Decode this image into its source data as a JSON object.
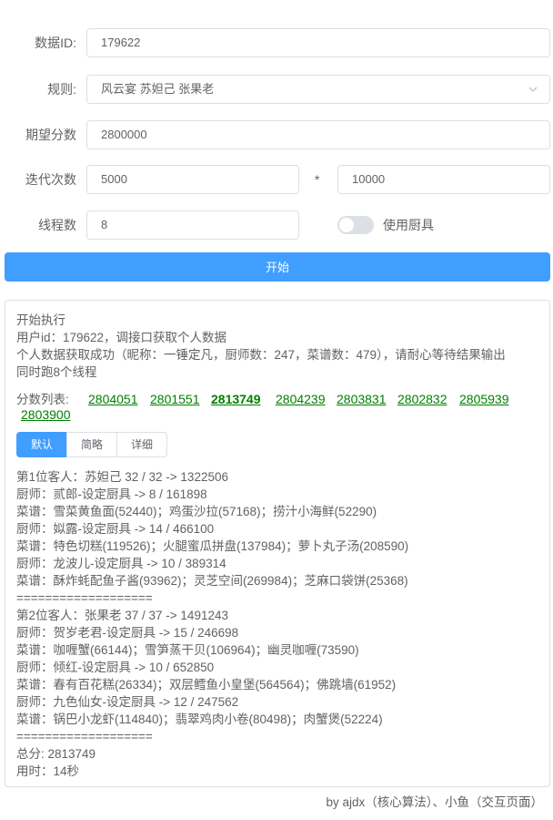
{
  "form": {
    "data_id": {
      "label": "数据ID:",
      "value": "179622"
    },
    "rule": {
      "label": "规则:",
      "value": "风云宴 苏妲己 张果老"
    },
    "expected_score": {
      "label": "期望分数",
      "value": "2800000"
    },
    "iterations": {
      "label": "迭代次数",
      "value_a": "5000",
      "multiply": "*",
      "value_b": "10000"
    },
    "threads": {
      "label": "线程数",
      "value": "8"
    },
    "use_tools": {
      "label": "使用厨具",
      "enabled": false
    }
  },
  "start_button": "开始",
  "output": {
    "log": [
      "开始执行",
      "用户id：179622，调接口获取个人数据",
      "个人数据获取成功（昵称：一锤定凡，厨师数：247，菜谱数：479），请耐心等待结果输出",
      "同时跑8个线程"
    ],
    "scores_label": "分数列表:",
    "scores": [
      "2804051",
      "2801551",
      "2813749",
      "2804239",
      "2803831",
      "2802832",
      "2805939",
      "2803900"
    ],
    "best_index": 2,
    "tabs": [
      "默认",
      "简略",
      "详细"
    ],
    "active_tab": 0,
    "result_lines": [
      "第1位客人：苏妲己 32 / 32 -> 1322506",
      "厨师：贰郎-设定厨具 -> 8 / 161898",
      "菜谱：雪菜黄鱼面(52440)；鸡蛋沙拉(57168)；捞汁小海鲜(52290)",
      "厨师：姒露-设定厨具 -> 14 / 466100",
      "菜谱：特色切糕(119526)；火腿蜜瓜拼盘(137984)；萝卜丸子汤(208590)",
      "厨师：龙波儿-设定厨具 -> 10 / 389314",
      "菜谱：酥炸蚝配鱼子酱(93962)；灵芝空间(269984)；芝麻口袋饼(25368)",
      "===================",
      "第2位客人：张果老 37 / 37 -> 1491243",
      "厨师：贺岁老君-设定厨具 -> 15 / 246698",
      "菜谱：咖喱蟹(66144)；雪笋蒸干贝(106964)；幽灵咖喱(73590)",
      "厨师：倾红-设定厨具 -> 10 / 652850",
      "菜谱：春有百花糕(26334)；双层鳕鱼小皇堡(564564)；佛跳墙(61952)",
      "厨师：九色仙女-设定厨具 -> 12 / 247562",
      "菜谱：锅巴小龙虾(114840)；翡翠鸡肉小卷(80498)；肉蟹煲(52224)",
      "===================",
      "总分: 2813749",
      "用时：14秒"
    ]
  },
  "footer": "by ajdx（核心算法）、小鱼（交互页面）",
  "colors": {
    "primary": "#409eff",
    "score": "#008000",
    "border": "#dcdfe6",
    "text": "#606266"
  }
}
